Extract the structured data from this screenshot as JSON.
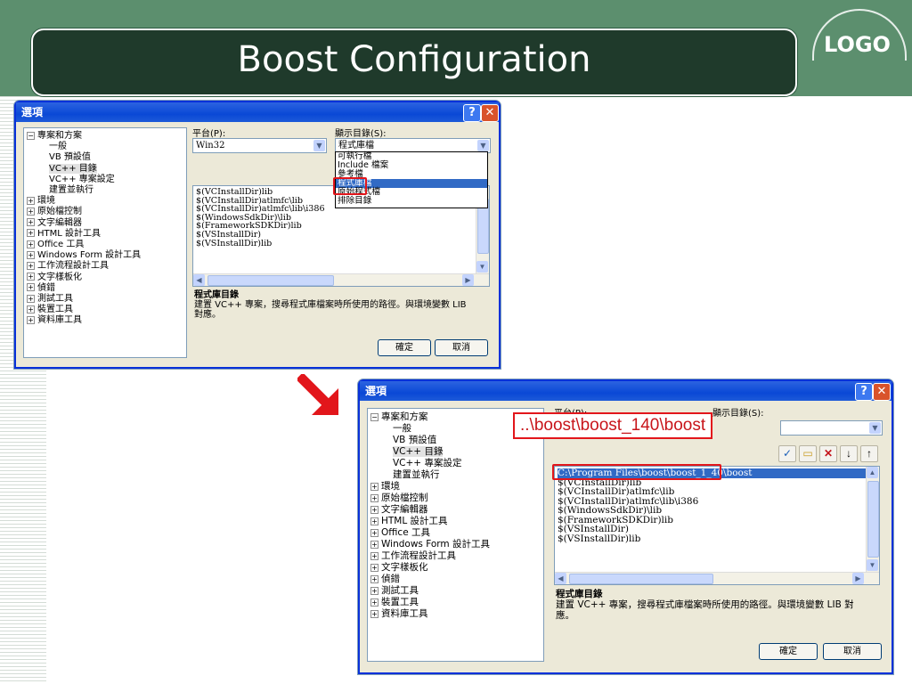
{
  "slide": {
    "title": "Boost Configuration",
    "logo": "LOGO",
    "colors": {
      "band": "#5c8f6e",
      "title_bg": "#1f3a2b",
      "highlight": "#e2161b",
      "selection": "#316ac5"
    }
  },
  "dialog1": {
    "title": "選項",
    "help_label": "?",
    "close_label": "✕",
    "tree": {
      "root": "專案和方案",
      "children": [
        "一般",
        "VB 預設值",
        "VC++ 目錄",
        "VC++ 專案設定",
        "建置並執行"
      ],
      "items": [
        "環境",
        "原始檔控制",
        "文字編輯器",
        "HTML 設計工具",
        "Office 工具",
        "Windows Form 設計工具",
        "工作流程設計工具",
        "文字樣板化",
        "偵錯",
        "測試工具",
        "裝置工具",
        "資料庫工具"
      ]
    },
    "platform_label": "平台(P):",
    "platform_value": "Win32",
    "show_dirs_label": "顯示目錄(S):",
    "show_dirs_value": "程式庫檔",
    "dropdown_options": [
      "可執行檔",
      "Include 檔案",
      "參考檔",
      "程式庫檔",
      "原始程式檔",
      "排除目錄"
    ],
    "dropdown_selected": "程式庫檔",
    "directories": [
      "$(VCInstallDir)lib",
      "$(VCInstallDir)atlmfc\\lib",
      "$(VCInstallDir)atlmfc\\lib\\i386",
      "$(WindowsSdkDir)\\lib",
      "$(FrameworkSDKDir)lib",
      "$(VSInstallDir)",
      "$(VSInstallDir)lib"
    ],
    "desc_title": "程式庫目錄",
    "desc_text": "建置 VC++ 專案，搜尋程式庫檔案時所使用的路徑。與環境變數 LIB 對應。",
    "ok_label": "確定",
    "cancel_label": "取消"
  },
  "dialog2": {
    "title": "選項",
    "help_label": "?",
    "close_label": "✕",
    "tree": {
      "root": "專案和方案",
      "children": [
        "一般",
        "VB 預設值",
        "VC++ 目錄",
        "VC++ 專案設定",
        "建置並執行"
      ],
      "items": [
        "環境",
        "原始檔控制",
        "文字編輯器",
        "HTML 設計工具",
        "Office 工具",
        "Windows Form 設計工具",
        "工作流程設計工具",
        "文字樣板化",
        "偵錯",
        "測試工具",
        "裝置工具",
        "資料庫工具"
      ]
    },
    "platform_label": "平台(P):",
    "show_dirs_label": "顯示目錄(S):",
    "toolbar_icons": [
      "check-icon",
      "new-folder-icon",
      "delete-icon",
      "move-down-icon",
      "move-up-icon"
    ],
    "directories": [
      "C:\\Program Files\\boost\\boost_1_40\\boost",
      "$(VCInstallDir)lib",
      "$(VCInstallDir)atlmfc\\lib",
      "$(VCInstallDir)atlmfc\\lib\\i386",
      "$(WindowsSdkDir)\\lib",
      "$(FrameworkSDKDir)lib",
      "$(VSInstallDir)",
      "$(VSInstallDir)lib"
    ],
    "desc_title": "程式庫目錄",
    "desc_text": "建置 VC++ 專案，搜尋程式庫檔案時所使用的路徑。與環境變數 LIB 對應。",
    "ok_label": "確定",
    "cancel_label": "取消"
  },
  "callout": {
    "text": "..\\boost\\boost_140\\boost"
  }
}
